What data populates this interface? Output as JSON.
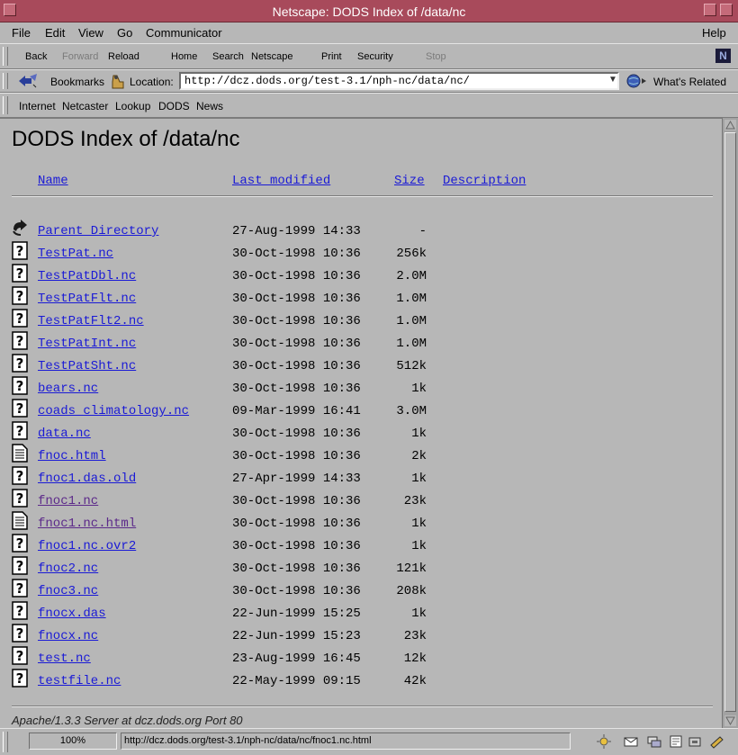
{
  "window": {
    "title": "Netscape: DODS Index of /data/nc"
  },
  "menu": [
    "File",
    "Edit",
    "View",
    "Go",
    "Communicator",
    "Help"
  ],
  "nav": {
    "back": "Back",
    "forward": "Forward",
    "reload": "Reload",
    "home": "Home",
    "search": "Search",
    "netscape": "Netscape",
    "print": "Print",
    "security": "Security",
    "stop": "Stop"
  },
  "location": {
    "bookmarks": "Bookmarks",
    "label": "Location:",
    "url": "http://dcz.dods.org/test-3.1/nph-nc/data/nc/",
    "whats_related": "What's Related"
  },
  "personal": [
    "Internet",
    "Netcaster",
    "Lookup",
    "DODS",
    "News"
  ],
  "page": {
    "title": "DODS Index of /data/nc",
    "columns": {
      "name": "Name",
      "modified": "Last modified",
      "size": "Size",
      "description": "Description"
    },
    "rows": [
      {
        "icon": "back-icon",
        "name": "Parent Directory",
        "modified": "27-Aug-1999 14:33",
        "size": "-",
        "visited": false
      },
      {
        "icon": "unknown-file-icon",
        "name": "TestPat.nc",
        "modified": "30-Oct-1998 10:36",
        "size": "256k",
        "visited": false
      },
      {
        "icon": "unknown-file-icon",
        "name": "TestPatDbl.nc",
        "modified": "30-Oct-1998 10:36",
        "size": "2.0M",
        "visited": false
      },
      {
        "icon": "unknown-file-icon",
        "name": "TestPatFlt.nc",
        "modified": "30-Oct-1998 10:36",
        "size": "1.0M",
        "visited": false
      },
      {
        "icon": "unknown-file-icon",
        "name": "TestPatFlt2.nc",
        "modified": "30-Oct-1998 10:36",
        "size": "1.0M",
        "visited": false
      },
      {
        "icon": "unknown-file-icon",
        "name": "TestPatInt.nc",
        "modified": "30-Oct-1998 10:36",
        "size": "1.0M",
        "visited": false
      },
      {
        "icon": "unknown-file-icon",
        "name": "TestPatSht.nc",
        "modified": "30-Oct-1998 10:36",
        "size": "512k",
        "visited": false
      },
      {
        "icon": "unknown-file-icon",
        "name": "bears.nc",
        "modified": "30-Oct-1998 10:36",
        "size": "1k",
        "visited": false
      },
      {
        "icon": "unknown-file-icon",
        "name": "coads_climatology.nc",
        "modified": "09-Mar-1999 16:41",
        "size": "3.0M",
        "visited": false
      },
      {
        "icon": "unknown-file-icon",
        "name": "data.nc",
        "modified": "30-Oct-1998 10:36",
        "size": "1k",
        "visited": false
      },
      {
        "icon": "text-file-icon",
        "name": "fnoc.html",
        "modified": "30-Oct-1998 10:36",
        "size": "2k",
        "visited": false
      },
      {
        "icon": "unknown-file-icon",
        "name": "fnoc1.das.old",
        "modified": "27-Apr-1999 14:33",
        "size": "1k",
        "visited": false
      },
      {
        "icon": "unknown-file-icon",
        "name": "fnoc1.nc",
        "modified": "30-Oct-1998 10:36",
        "size": "23k",
        "visited": true
      },
      {
        "icon": "text-file-icon",
        "name": "fnoc1.nc.html",
        "modified": "30-Oct-1998 10:36",
        "size": "1k",
        "visited": true
      },
      {
        "icon": "unknown-file-icon",
        "name": "fnoc1.nc.ovr2",
        "modified": "30-Oct-1998 10:36",
        "size": "1k",
        "visited": false
      },
      {
        "icon": "unknown-file-icon",
        "name": "fnoc2.nc",
        "modified": "30-Oct-1998 10:36",
        "size": "121k",
        "visited": false
      },
      {
        "icon": "unknown-file-icon",
        "name": "fnoc3.nc",
        "modified": "30-Oct-1998 10:36",
        "size": "208k",
        "visited": false
      },
      {
        "icon": "unknown-file-icon",
        "name": "fnocx.das",
        "modified": "22-Jun-1999 15:25",
        "size": "1k",
        "visited": false
      },
      {
        "icon": "unknown-file-icon",
        "name": "fnocx.nc",
        "modified": "22-Jun-1999 15:23",
        "size": "23k",
        "visited": false
      },
      {
        "icon": "unknown-file-icon",
        "name": "test.nc",
        "modified": "23-Aug-1999 16:45",
        "size": "12k",
        "visited": false
      },
      {
        "icon": "unknown-file-icon",
        "name": "testfile.nc",
        "modified": "22-May-1999 09:15",
        "size": "42k",
        "visited": false
      }
    ],
    "footer": "Apache/1.3.3 Server at dcz.dods.org Port 80"
  },
  "status": {
    "progress": "100%",
    "text": "http://dcz.dods.org/test-3.1/nph-nc/data/nc/fnoc1.nc.html"
  },
  "colors": {
    "titlebar": "#a84a5b",
    "link": "#1a1ad6",
    "visited": "#5c2a8a",
    "background": "#b7b7b7"
  }
}
